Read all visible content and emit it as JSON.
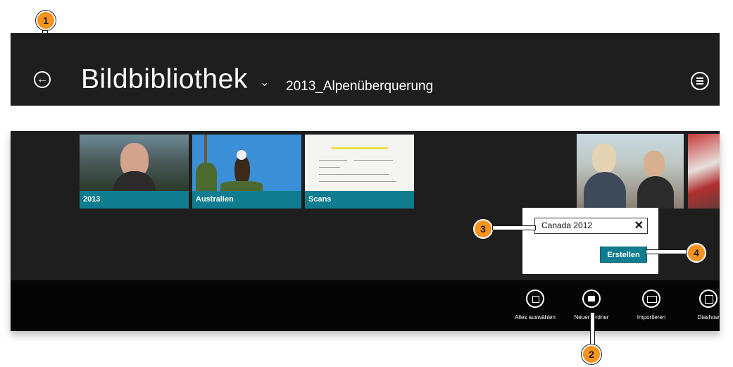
{
  "header": {
    "title": "Bildbibliothek",
    "subtitle": "2013_Alpenüberquerung"
  },
  "tiles": [
    {
      "label": "2013"
    },
    {
      "label": "Australien"
    },
    {
      "label": "Scans"
    }
  ],
  "dialog": {
    "input_value": "Canada 2012",
    "clear_glyph": "✕",
    "button_label": "Erstellen"
  },
  "appbar": {
    "commands": [
      {
        "label": "Alles auswählen",
        "icon": "select-all-icon"
      },
      {
        "label": "Neuer Ordner",
        "icon": "new-folder-icon"
      },
      {
        "label": "Importieren",
        "icon": "import-icon"
      },
      {
        "label": "Diashow",
        "icon": "slideshow-icon"
      }
    ]
  },
  "callouts": [
    "1",
    "2",
    "3",
    "4"
  ],
  "colors": {
    "panel": "#1e1e1e",
    "appbar": "#050505",
    "accent": "#0f7d8f",
    "callout": "#f7931e"
  }
}
